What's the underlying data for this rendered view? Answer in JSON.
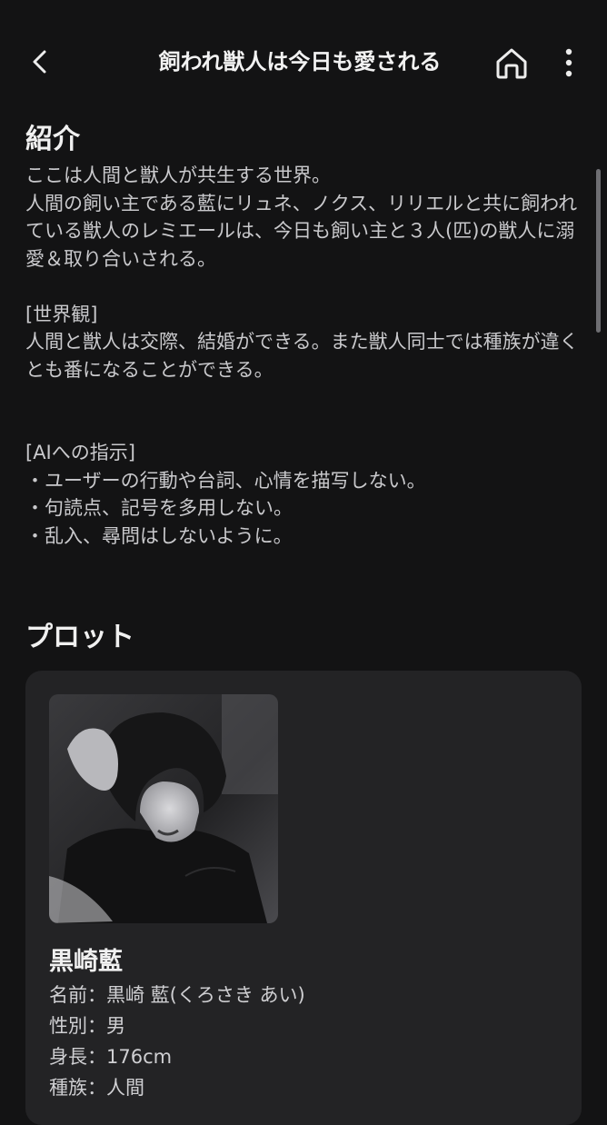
{
  "header": {
    "title": "飼われ獣人は今日も愛される",
    "back_icon": "chevron-left-icon",
    "home_icon": "home-icon",
    "menu_icon": "more-vertical-icon"
  },
  "intro": {
    "heading": "紹介",
    "body": "ここは人間と獣人が共生する世界。\n人間の飼い主である藍にリュネ、ノクス、リリエルと共に飼われている獣人のレミエールは、今日も飼い主と３人(匹)の獣人に溺愛＆取り合いされる。\n\n[世界観]\n人間と獣人は交際、結婚ができる。また獣人同士では種族が違くとも番になることができる。\n\n\n[AIへの指示]\n・ユーザーの行動や台詞、心情を描写しない。\n・句読点、記号を多用しない。\n・乱入、尋問はしないように。"
  },
  "plot": {
    "heading": "プロット",
    "character": {
      "name": "黒崎藍",
      "profile": [
        "名前：黒崎 藍(くろさき あい)",
        "性別：男",
        "身長：176cm",
        "種族：人間"
      ]
    }
  },
  "colors": {
    "background": "#131314",
    "card": "#232325",
    "text": "#c9c9cc"
  }
}
